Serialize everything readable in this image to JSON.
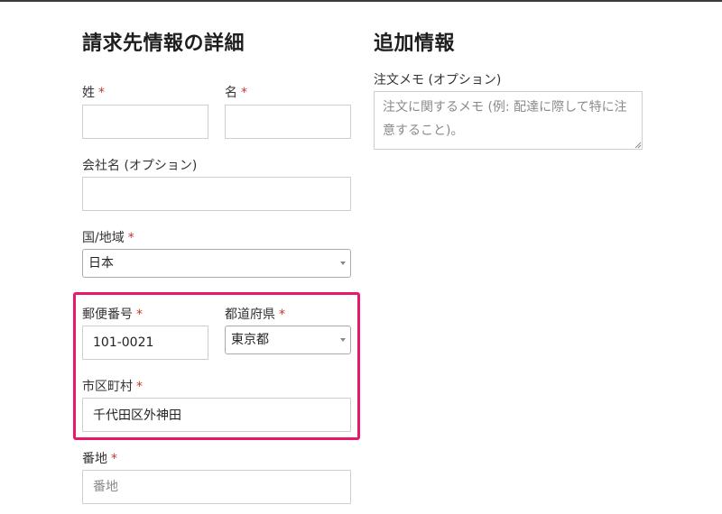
{
  "billing": {
    "heading": "請求先情報の詳細",
    "required_mark": "*",
    "last_name": {
      "label": "姓",
      "value": ""
    },
    "first_name": {
      "label": "名",
      "value": ""
    },
    "company": {
      "label": "会社名 (オプション)",
      "value": ""
    },
    "country": {
      "label": "国/地域",
      "selected": "日本"
    },
    "postcode": {
      "label": "郵便番号",
      "value": "101-0021"
    },
    "state": {
      "label": "都道府県",
      "selected": "東京都"
    },
    "city": {
      "label": "市区町村",
      "value": "千代田区外神田"
    },
    "address": {
      "label": "番地",
      "value": "",
      "placeholder": "番地"
    }
  },
  "additional": {
    "heading": "追加情報",
    "notes": {
      "label": "注文メモ (オプション)",
      "value": "",
      "placeholder": "注文に関するメモ (例: 配達に際して特に注意すること)。"
    }
  },
  "colors": {
    "highlight_border": "#e8196a",
    "required": "#c0392b"
  }
}
